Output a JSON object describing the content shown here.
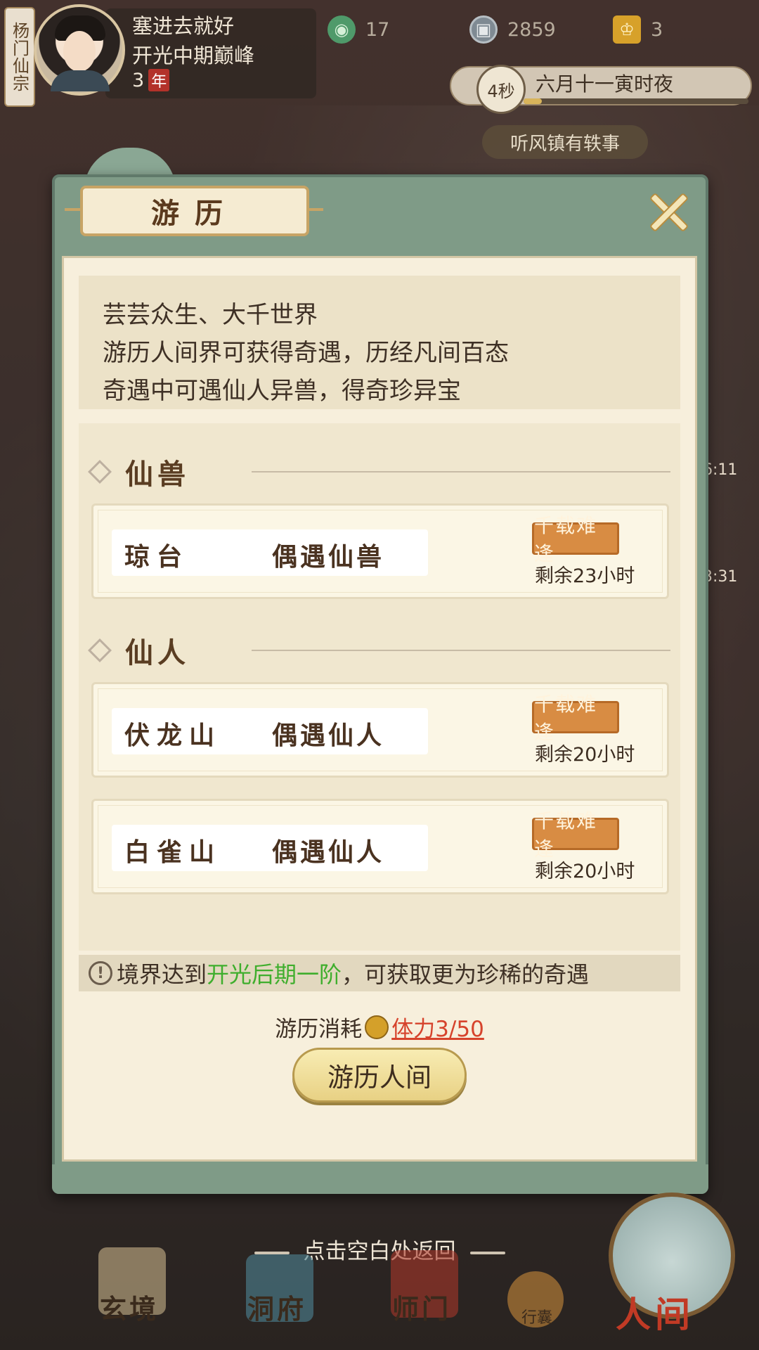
{
  "top": {
    "sect": "杨门仙宗",
    "player_name": "塞进去就好",
    "realm": "开光中期巅峰",
    "age_value": "3",
    "age_unit": "年",
    "resources": [
      {
        "icon": "jade-spirit-icon",
        "value": "17"
      },
      {
        "icon": "coin-icon",
        "value": "2859"
      },
      {
        "icon": "gold-ingot-icon",
        "value": "3"
      }
    ],
    "timer": "4秒",
    "date_text": "六月十一寅时夜",
    "event_banner": "听风镇有轶事",
    "side_timers": [
      "6:11",
      "3:31"
    ]
  },
  "panel": {
    "title": "游历",
    "intro": [
      "芸芸众生、大千世界",
      "游历人间界可获得奇遇，历经凡间百态",
      "奇遇中可遇仙人异兽，得奇珍异宝"
    ],
    "sections": [
      {
        "label": "仙兽"
      },
      {
        "label": "仙人"
      }
    ],
    "cards": [
      {
        "place": "琼台",
        "event": "偶遇仙兽",
        "rarity": "千载难逢",
        "remain": "剩余23小时"
      },
      {
        "place": "伏龙山",
        "event": "偶遇仙人",
        "rarity": "千载难逢",
        "remain": "剩余20小时"
      },
      {
        "place": "白雀山",
        "event": "偶遇仙人",
        "rarity": "千载难逢",
        "remain": "剩余20小时"
      }
    ],
    "notice_pre": "境界达到",
    "notice_highlight": "开光后期一阶",
    "notice_post": "，可获取更为珍稀的奇遇",
    "cost_label": "游历消耗",
    "stamina": "体力3/50",
    "travel_button": "游历人间"
  },
  "bottom": {
    "tap_hint": "点击空白处返回",
    "nav": [
      "玄境",
      "洞府",
      "师门",
      "行囊",
      "人间"
    ]
  },
  "colors": {
    "panel_frame": "#7f9b87",
    "panel_paper": "#f7efdc",
    "rarity_badge": "#d88c43",
    "highlight_green": "#3fae2d",
    "stamina_red": "#d6432c"
  }
}
